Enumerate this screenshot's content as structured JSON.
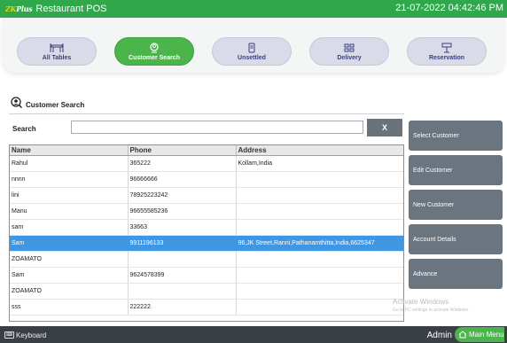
{
  "window": {
    "logo_part1": "ZK",
    "logo_part2": "Plus",
    "title": "Restaurant POS",
    "datetime": "21-07-2022 04:42:46 PM"
  },
  "nav": {
    "tabs": [
      {
        "label": "All Tables",
        "icon": "table-icon",
        "active": false
      },
      {
        "label": "Customer Search",
        "icon": "customer-search-icon",
        "active": true
      },
      {
        "label": "Unsettled",
        "icon": "receipt-icon",
        "active": false
      },
      {
        "label": "Delivery",
        "icon": "delivery-icon",
        "active": false
      },
      {
        "label": "Reservation",
        "icon": "reservation-icon",
        "active": false
      }
    ]
  },
  "section": {
    "title": "Customer Search",
    "icon": "customer-search-icon"
  },
  "search": {
    "label": "Search",
    "value": "",
    "placeholder": "",
    "clear_label": "X"
  },
  "table": {
    "columns": [
      "Name",
      "Phone",
      "Address"
    ],
    "rows": [
      {
        "name": "Rahul",
        "phone": "365222",
        "address": "Kollam,India",
        "selected": false
      },
      {
        "name": "nnnn",
        "phone": "96666666",
        "address": "",
        "selected": false
      },
      {
        "name": "lini",
        "phone": "78925223242",
        "address": "",
        "selected": false
      },
      {
        "name": "Manu",
        "phone": "96655585236",
        "address": "",
        "selected": false
      },
      {
        "name": "sam",
        "phone": "33663",
        "address": "",
        "selected": false
      },
      {
        "name": "Sam",
        "phone": "9911196133",
        "address": "96,JK Street,Ranni,Pathanamthitta,India,6625347",
        "selected": true
      },
      {
        "name": "ZOAMATO",
        "phone": "",
        "address": "",
        "selected": false
      },
      {
        "name": "Sam",
        "phone": "9624578399",
        "address": "",
        "selected": false
      },
      {
        "name": "ZOAMATO",
        "phone": "",
        "address": "",
        "selected": false
      },
      {
        "name": "sss",
        "phone": "222222",
        "address": "",
        "selected": false
      }
    ]
  },
  "actions": {
    "select_customer": "Select Customer",
    "edit_customer": "Edit Customer",
    "new_customer": "New Customer",
    "account_details": "Account Details",
    "advance": "Advance"
  },
  "watermark": {
    "line1": "Activate Windows",
    "line2": "Go to PC settings to activate Windows."
  },
  "footer": {
    "keyboard_label": "Keyboard",
    "user": "Admin",
    "main_menu_label": "Main Menu"
  },
  "colors": {
    "brand_green": "#2ea84a",
    "active_tab": "#4bb54c",
    "selection_blue": "#3f96e3",
    "action_button": "#6b7580"
  }
}
